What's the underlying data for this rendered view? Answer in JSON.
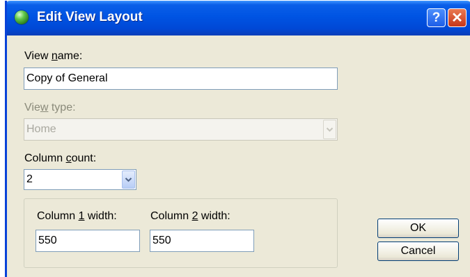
{
  "window": {
    "title": "Edit View Layout",
    "icon": "app-globe-icon",
    "help_glyph": "?",
    "close_glyph": "✕"
  },
  "form": {
    "view_name": {
      "label_pre": "View ",
      "label_mn": "n",
      "label_post": "ame:",
      "value": "Copy of General"
    },
    "view_type": {
      "label_pre": "Vie",
      "label_mn": "w",
      "label_post": " type:",
      "value": "Home",
      "enabled": false
    },
    "column_count": {
      "label_pre": "Column ",
      "label_mn": "c",
      "label_post": "ount:",
      "value": "2"
    },
    "column1": {
      "label_pre": "Column ",
      "label_mn": "1",
      "label_post": " width:",
      "value": "550"
    },
    "column2": {
      "label_pre": "Column ",
      "label_mn": "2",
      "label_post": " width:",
      "value": "550"
    }
  },
  "buttons": {
    "ok": "OK",
    "cancel": "Cancel"
  },
  "colors": {
    "titlebar": "#0054e3",
    "window_bg": "#ece9d8",
    "input_border": "#7f9db9"
  }
}
